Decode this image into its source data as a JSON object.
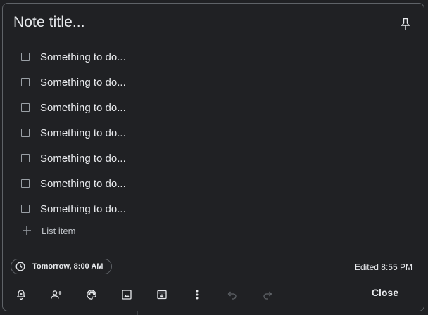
{
  "note": {
    "title_placeholder": "Note title...",
    "items": [
      {
        "text": "Something to do...",
        "checked": false
      },
      {
        "text": "Something to do...",
        "checked": false
      },
      {
        "text": "Something to do...",
        "checked": false
      },
      {
        "text": "Something to do...",
        "checked": false
      },
      {
        "text": "Something to do...",
        "checked": false
      },
      {
        "text": "Something to do...",
        "checked": false
      },
      {
        "text": "Something to do...",
        "checked": false
      }
    ],
    "add_item_label": "List item",
    "reminder_chip": "Tomorrow, 8:00 AM",
    "edited": "Edited 8:55 PM"
  },
  "toolbar": {
    "icons": [
      "add-alert-icon",
      "add-collaborator-icon",
      "palette-icon",
      "image-icon",
      "archive-icon",
      "more-vert-icon",
      "undo-icon",
      "redo-icon"
    ],
    "close_label": "Close"
  },
  "colors": {
    "background": "#202124",
    "border": "#5f6368",
    "text": "#e8eaed",
    "muted_icon": "#5f6368"
  }
}
